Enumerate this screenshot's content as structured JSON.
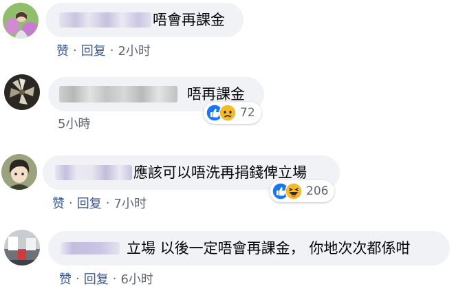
{
  "comments": [
    {
      "text": "唔會再課金",
      "actions": {
        "like": "赞",
        "reply": "回复",
        "time": "2小时"
      }
    },
    {
      "text": "唔再課金",
      "time": "5小時",
      "reactions": {
        "icons": [
          "like-icon",
          "sad-icon"
        ],
        "count": "72"
      }
    },
    {
      "text": "應該可以唔洗再捐錢俾立場",
      "actions": {
        "like": "赞",
        "reply": "回复",
        "time": "7小时"
      },
      "reactions": {
        "icons": [
          "like-icon",
          "haha-icon"
        ],
        "count": "206"
      }
    },
    {
      "text": "立場 以後一定唔會再課金， 你地次次都係咁",
      "actions": {
        "like": "赞",
        "reply": "回复",
        "time": "6小时"
      }
    }
  ],
  "colors": {
    "bubble": "#f0f2f5",
    "link": "#385898",
    "meta": "#606770",
    "like": "#1877f2",
    "emoji": "#f7b928"
  },
  "separator": "·"
}
